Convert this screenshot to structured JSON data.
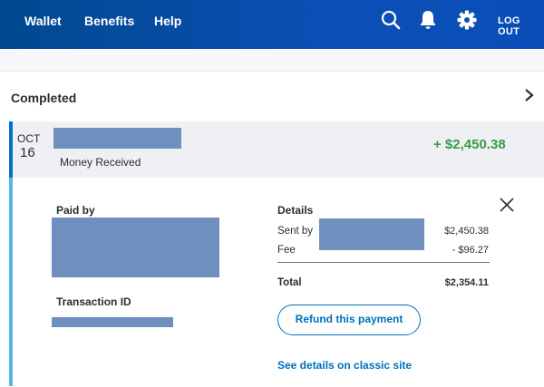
{
  "nav": {
    "items": [
      {
        "label": "Wallet"
      },
      {
        "label": "Benefits"
      },
      {
        "label": "Help"
      }
    ],
    "icons": [
      "search-icon",
      "bell-icon",
      "gear-icon"
    ],
    "logout": "LOG OUT"
  },
  "section": {
    "title": "Completed"
  },
  "transaction": {
    "month": "OCT",
    "day": "16",
    "type": "Money Received",
    "amount": "+ $2,450.38",
    "amount_color": "#3b9a4a"
  },
  "details": {
    "paid_by_label": "Paid by",
    "transaction_id_label": "Transaction ID",
    "heading": "Details",
    "sent_by_label": "Sent by",
    "sent_by_amount": "$2,450.38",
    "fee_label": "Fee",
    "fee_amount": "- $96.27",
    "total_label": "Total",
    "total_amount": "$2,354.11",
    "refund_button": "Refund this payment",
    "classic_link": "See details on classic site"
  },
  "colors": {
    "accent": "#0070ba",
    "nav": "#0b4fb5",
    "redaction": "#6f8fbf"
  }
}
